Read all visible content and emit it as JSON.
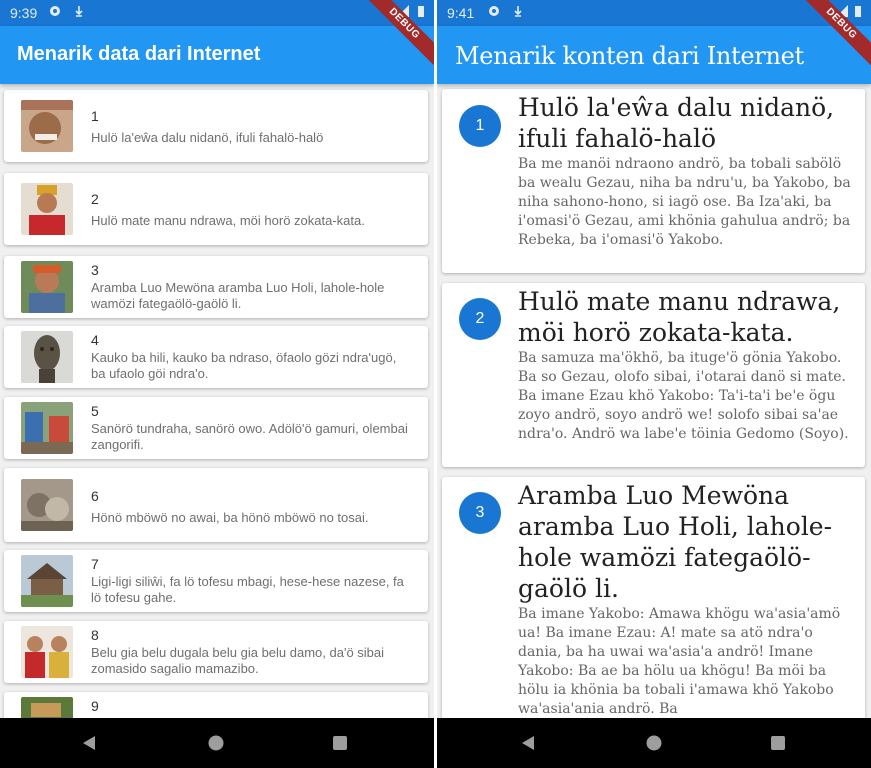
{
  "left": {
    "status_time": "9:39",
    "title": "Menarik data dari Internet",
    "ribbon": "DEBUG",
    "items": [
      {
        "num": "1",
        "text": "Hulö la'eŵa dalu nidanö, ifuli fahalö-halö"
      },
      {
        "num": "2",
        "text": "Hulö mate manu ndrawa, möi horö zokata-kata."
      },
      {
        "num": "3",
        "text": "Aramba Luo Mewöna aramba Luo Holi, lahole-hole wamözi fategaölö-gaölö li."
      },
      {
        "num": "4",
        "text": "Kauko ba hili, kauko ba ndraso, öfaolo gözi ndra'ugö, ba ufaolo göi ndra'o."
      },
      {
        "num": "5",
        "text": "Sanörö tundraha, sanörö owo. Adölö'ö gamuri, olembai zangorifi."
      },
      {
        "num": "6",
        "text": "Hönö mböwö no awai, ba hönö mböwö no tosai."
      },
      {
        "num": "7",
        "text": "Ligi-ligi siliŵi, fa lö tofesu mbagi, hese-hese nazese, fa lö tofesu gahe."
      },
      {
        "num": "8",
        "text": "Belu gia belu dugala belu gia belu damo, da'ö sibai zomasido sagalio mamazibo."
      },
      {
        "num": "9",
        "text": ""
      }
    ]
  },
  "right": {
    "status_time": "9:41",
    "title": "Menarik konten dari Internet",
    "ribbon": "DEBUG",
    "items": [
      {
        "num": "1",
        "title": "Hulö la'eŵa dalu nidanö, ifuli fahalö-halö",
        "body": "Ba me manöi ndraono andrö, ba tobali sabölö ba wealu Gezau, niha ba ndru'u, ba Yakobo, ba niha sahono-hono, si iagö ose. Ba Iza'aki, ba i'omasi'ö Gezau, ami khönia gahulua andrö; ba Rebeka, ba i'omasi'ö Yakobo."
      },
      {
        "num": "2",
        "title": "Hulö mate manu ndrawa, möi horö zokata-kata.",
        "body": "Ba samuza ma'ökhö, ba ituge'ö gönia Yakobo. Ba so Gezau, olofo sibai, i'otarai danö si mate. Ba imane Ezau khö Yakobo: Ta'i-ta'i be'e ögu zoyo andrö, soyo andrö we! solofo sibai sa'ae ndra'o. Andrö wa labe'e töinia Gedomo (Soyo)."
      },
      {
        "num": "3",
        "title": "Aramba Luo Mewöna aramba Luo Holi, lahole-hole wamözi fategaölö-gaölö li.",
        "body": "Ba imane Yakobo: Amawa khögu wa'asia'amö ua! Ba imane Ezau: A! mate sa atö ndra'o dania, ba ha uwai wa'asia'a andrö! Imane Yakobo: Ba ae ba hölu ua khögu! Ba möi ba hölu ia khönia ba tobali i'amawa khö Yakobo wa'asia'ania andrö. Ba"
      }
    ]
  },
  "colors": {
    "appbar": "#2196f3",
    "statusbar": "#1976d2",
    "badge": "#1976d2",
    "ribbon": "#a32a2a"
  }
}
